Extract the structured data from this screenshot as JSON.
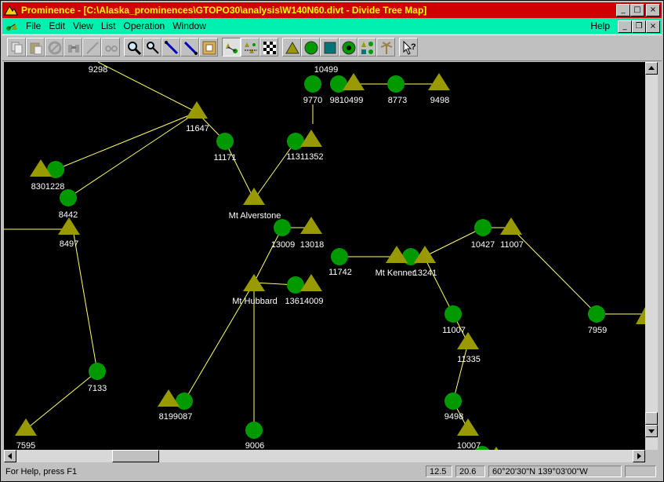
{
  "window": {
    "app_name": "Prominence",
    "title": "Prominence - [C:\\Alaska_prominences\\GTOPO30\\analysis\\W140N60.divt - Divide Tree Map]"
  },
  "menubar": {
    "items": [
      {
        "label": "File"
      },
      {
        "label": "Edit"
      },
      {
        "label": "View"
      },
      {
        "label": "List"
      },
      {
        "label": "Operation"
      },
      {
        "label": "Window"
      }
    ],
    "help": "Help"
  },
  "toolbar": {
    "icons": [
      "copy-icon",
      "paste-icon",
      "tools-icon",
      "binoculars-icon",
      "line-icon",
      "eyeglasses-icon",
      "zoom-in-icon",
      "zoom-out-icon",
      "measure-icon",
      "measure-alt-icon",
      "frame-icon",
      "peak-saddle-icon",
      "tree-icon",
      "checker-icon",
      "peak-icon",
      "saddle-icon",
      "basin-icon",
      "runoff-icon",
      "all-features-icon",
      "palm-icon",
      "help-pointer-icon"
    ]
  },
  "colors": {
    "peak": "#999900",
    "saddle": "#009900",
    "line": "#ffff66",
    "background": "#000000",
    "titlebar": "#d00000",
    "menubar": "#00f0b0"
  },
  "map": {
    "labels": [
      "9298",
      "10499",
      "9770",
      "9810499",
      "8773",
      "9498",
      "11647",
      "11171",
      "11311352",
      "8301228",
      "8442",
      "8497",
      "Mt Alverstone",
      "13009",
      "13018",
      "11742",
      "Mt Kenner",
      "13241",
      "10427",
      "11007",
      "Mt Hubbard",
      "13614009",
      "11007",
      "7959",
      "11335",
      "7133",
      "8199087",
      "9498",
      "9006",
      "10007",
      "7595"
    ]
  },
  "status": {
    "help_text": "For Help, press F1",
    "pane1": "12.5",
    "pane2": "20.6",
    "coords": "60°20'30\"N 139°03'00\"W"
  }
}
